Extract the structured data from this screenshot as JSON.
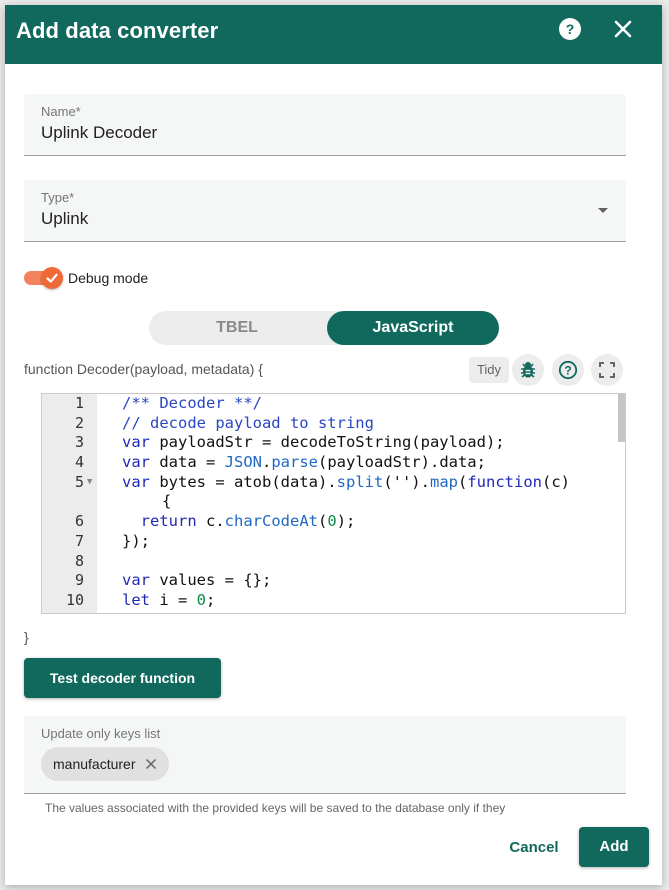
{
  "dialog": {
    "title": "Add data converter",
    "help_icon": "help-circle-icon",
    "close_icon": "close-icon"
  },
  "name_field": {
    "label": "Name*",
    "value": "Uplink Decoder"
  },
  "type_field": {
    "label": "Type*",
    "value": "Uplink"
  },
  "debug": {
    "label": "Debug mode",
    "enabled": true
  },
  "language_toggle": {
    "options": [
      "TBEL",
      "JavaScript"
    ],
    "selected": "JavaScript"
  },
  "editor": {
    "signature": "function Decoder(payload, metadata) {",
    "tidy_label": "Tidy",
    "closing": "}",
    "line_numbers": [
      "1",
      "2",
      "3",
      "4",
      "5",
      "6",
      "7",
      "8",
      "9",
      "10"
    ],
    "lines": [
      "/** Decoder **/",
      "// decode payload to string",
      "var payloadStr = decodeToString(payload);",
      "var data = JSON.parse(payloadStr).data;",
      "var bytes = atob(data).split('').map(function(c)",
      "{",
      "  return c.charCodeAt(0);",
      "});",
      "",
      "var values = {};",
      "let i = 0;"
    ]
  },
  "test_button": {
    "label": "Test decoder function"
  },
  "keys": {
    "label": "Update only keys list",
    "chips": [
      "manufacturer"
    ],
    "hint": "The values associated with the provided keys will be saved to the database only if they"
  },
  "actions": {
    "cancel": "Cancel",
    "add": "Add"
  },
  "colors": {
    "primary": "#11695e",
    "accent": "#f06a37"
  }
}
